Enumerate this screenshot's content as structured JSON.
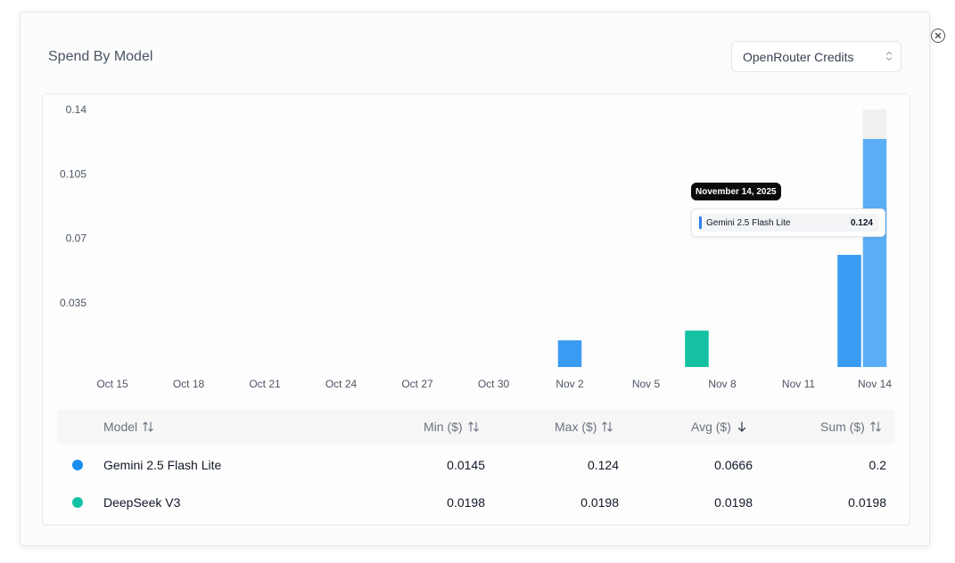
{
  "card": {
    "title": "Spend By Model"
  },
  "select": {
    "value": "OpenRouter Credits"
  },
  "tooltip": {
    "date": "November 14, 2025",
    "series": "Gemini 2.5 Flash Lite",
    "value": "0.124"
  },
  "table": {
    "headers": {
      "model": "Model",
      "min": "Min ($)",
      "max": "Max ($)",
      "avg": "Avg ($)",
      "sum": "Sum ($)"
    },
    "rows": [
      {
        "model": "Gemini 2.5 Flash Lite",
        "color": "#1a8cf0",
        "min": "0.0145",
        "max": "0.124",
        "avg": "0.0666",
        "sum": "0.2"
      },
      {
        "model": "DeepSeek V3",
        "color": "#14c2a3",
        "min": "0.0198",
        "max": "0.0198",
        "avg": "0.0198",
        "sum": "0.0198"
      }
    ]
  },
  "chart_data": {
    "type": "bar",
    "title": "Spend By Model",
    "xlabel": "",
    "ylabel": "",
    "x_ticks": [
      "Oct 15",
      "Oct 18",
      "Oct 21",
      "Oct 24",
      "Oct 27",
      "Oct 30",
      "Nov 2",
      "Nov 5",
      "Nov 8",
      "Nov 11",
      "Nov 14"
    ],
    "y_ticks": [
      "0.035",
      "0.07",
      "0.105",
      "0.14"
    ],
    "ylim": [
      0,
      0.14
    ],
    "grid": false,
    "legend": "none",
    "bars": [
      {
        "date": "Nov 2",
        "series": "Gemini 2.5 Flash Lite",
        "value": 0.0145,
        "color": "#3a9bf2"
      },
      {
        "date": "Nov 7",
        "series": "DeepSeek V3",
        "value": 0.0198,
        "color": "#14c2a3"
      },
      {
        "date": "Nov 13",
        "series": "Gemini 2.5 Flash Lite",
        "value": 0.061,
        "color": "#3a9bf2"
      },
      {
        "date": "Nov 14",
        "series": "Gemini 2.5 Flash Lite",
        "value": 0.124,
        "color": "#5aaef5",
        "highlighted": true
      }
    ]
  }
}
